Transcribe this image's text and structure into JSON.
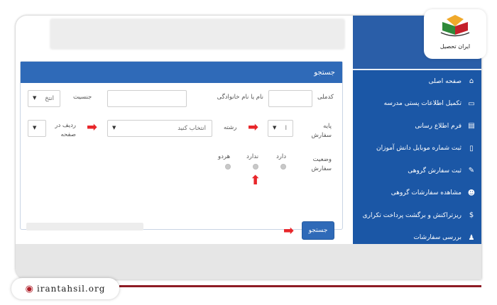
{
  "brand": {
    "logo_text": "ایران تحصیل",
    "site_url": "irantahsil.org"
  },
  "sidebar": {
    "items": [
      {
        "label": "صفحه اصلی",
        "icon": "home-icon",
        "glyph": "⌂"
      },
      {
        "label": "تکمیل اطلاعات پستی مدرسه",
        "icon": "card-icon",
        "glyph": "▭"
      },
      {
        "label": "فرم اطلاع رسانی",
        "icon": "print-icon",
        "glyph": "▤"
      },
      {
        "label": "ثبت شماره موبایل دانش آموزان",
        "icon": "mobile-icon",
        "glyph": "▯"
      },
      {
        "label": "ثبت سفارش گروهی",
        "icon": "edit-icon",
        "glyph": "✎"
      },
      {
        "label": "مشاهده سفارشات گروهی",
        "icon": "users-icon",
        "glyph": "☻"
      },
      {
        "label": "ریزتراکنش و برگشت پرداخت تکراری",
        "icon": "dollar-icon",
        "glyph": "$"
      },
      {
        "label": "بررسی سفارشات",
        "icon": "user-icon",
        "glyph": "♟"
      }
    ]
  },
  "search_panel": {
    "title": "جستجو",
    "fields": {
      "code_label": "کدملی",
      "name_label": "نام یا نام خانوادگی",
      "gender_label": "جنسیت",
      "gender_value": "انتخ",
      "grade_label": "پایه سفارش",
      "grade_value": "ا",
      "field_label": "رشته",
      "field_value": "انتخاب کنید",
      "rows_label": "ردیف در صفحه",
      "rows_value": ""
    },
    "status": {
      "label": "وضعیت سفارش",
      "options": [
        "دارد",
        "ندارد",
        "هردو"
      ]
    },
    "search_button": "جستجو"
  },
  "colors": {
    "sidebar": "#1b57a6",
    "accent": "#2f6ab8",
    "arrow": "#e8262a"
  }
}
